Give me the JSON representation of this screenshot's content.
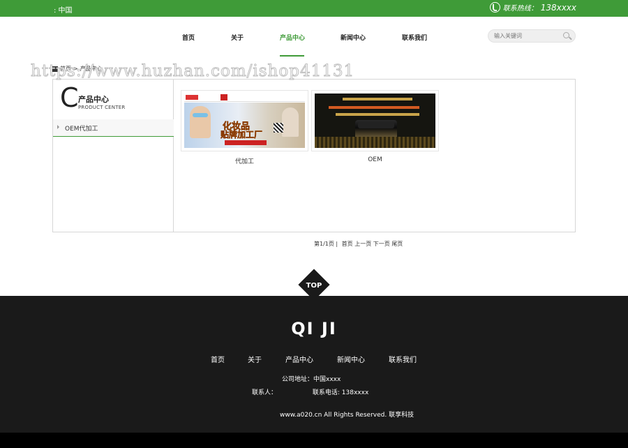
{
  "topbar": {
    "location": ": 中国",
    "hotline_label": "联系热线：",
    "hotline_number": "138xxxx"
  },
  "nav": {
    "items": [
      "首页",
      "关于",
      "产品中心",
      "新闻中心",
      "联系我们"
    ],
    "active": "产品中心"
  },
  "search": {
    "placeholder": "输入关键词"
  },
  "breadcrumb": {
    "home": "首页",
    "sep": ">",
    "current": "产品中心"
  },
  "watermark": "https://www.huzhan.com/ishop41131",
  "sidebar": {
    "letter": "C",
    "title_cn": "产品中心",
    "title_en": "PRODUCT CENTER",
    "items": [
      {
        "label": "OEM代加工"
      }
    ]
  },
  "products": [
    {
      "title": "代加工",
      "banner_lines": [
        "化妆品",
        "贴牌加工厂"
      ]
    },
    {
      "title": "OEM"
    }
  ],
  "pager": {
    "summary": "第1/1页 |",
    "first": "首页",
    "prev": "上一页",
    "next": "下一页",
    "last": "尾页"
  },
  "top_button": "TOP",
  "footer": {
    "logo": "QI JI",
    "nav": [
      "首页",
      "关于",
      "产品中心",
      "新闻中心",
      "联系我们"
    ],
    "address": "公司地址：中国xxxx",
    "contact_label": "联系人：",
    "phone": "联系电话:   138xxxx",
    "copyright": "www.a020.cn All Rights Reserved. 联享科技"
  },
  "colors": {
    "accent": "#3f9b38",
    "footer_bg": "#1a1a1a"
  }
}
